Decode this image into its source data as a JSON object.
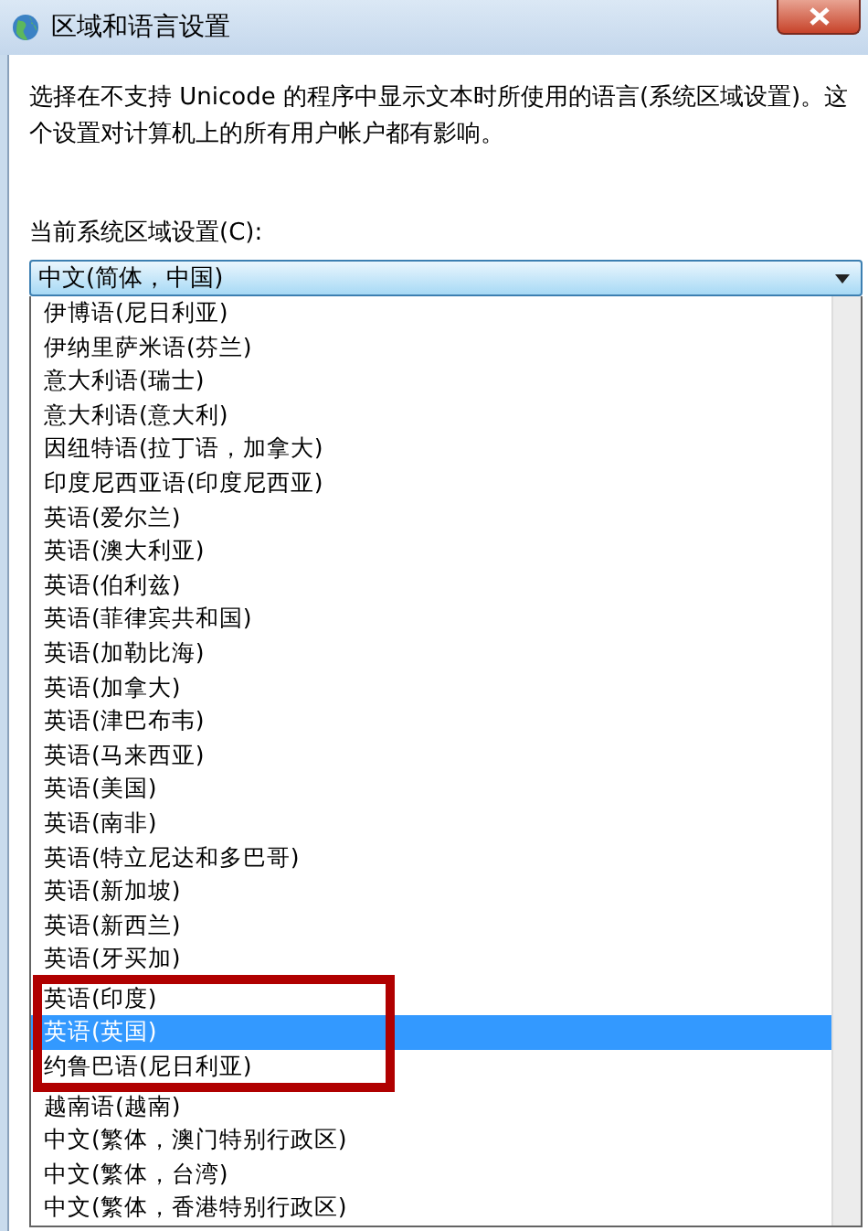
{
  "window": {
    "title": "区域和语言设置"
  },
  "description": "选择在不支持 Unicode 的程序中显示文本时所使用的语言(系统区域设置)。这个设置对计算机上的所有用户帐户都有影响。",
  "locale_label": "当前系统区域设置(C):",
  "locale_dropdown": {
    "value": "中文(简体，中国)",
    "expanded": true,
    "options": [
      {
        "label": "伊博语(尼日利亚)",
        "selected": false,
        "highlighted": false
      },
      {
        "label": "伊纳里萨米语(芬兰)",
        "selected": false,
        "highlighted": false
      },
      {
        "label": "意大利语(瑞士)",
        "selected": false,
        "highlighted": false
      },
      {
        "label": "意大利语(意大利)",
        "selected": false,
        "highlighted": false
      },
      {
        "label": "因纽特语(拉丁语，加拿大)",
        "selected": false,
        "highlighted": false
      },
      {
        "label": "印度尼西亚语(印度尼西亚)",
        "selected": false,
        "highlighted": false
      },
      {
        "label": "英语(爱尔兰)",
        "selected": false,
        "highlighted": false
      },
      {
        "label": "英语(澳大利亚)",
        "selected": false,
        "highlighted": false
      },
      {
        "label": "英语(伯利兹)",
        "selected": false,
        "highlighted": false
      },
      {
        "label": "英语(菲律宾共和国)",
        "selected": false,
        "highlighted": false
      },
      {
        "label": "英语(加勒比海)",
        "selected": false,
        "highlighted": false
      },
      {
        "label": "英语(加拿大)",
        "selected": false,
        "highlighted": false
      },
      {
        "label": "英语(津巴布韦)",
        "selected": false,
        "highlighted": false
      },
      {
        "label": "英语(马来西亚)",
        "selected": false,
        "highlighted": false
      },
      {
        "label": "英语(美国)",
        "selected": false,
        "highlighted": false
      },
      {
        "label": "英语(南非)",
        "selected": false,
        "highlighted": false
      },
      {
        "label": "英语(特立尼达和多巴哥)",
        "selected": false,
        "highlighted": false
      },
      {
        "label": "英语(新加坡)",
        "selected": false,
        "highlighted": false
      },
      {
        "label": "英语(新西兰)",
        "selected": false,
        "highlighted": false
      },
      {
        "label": "英语(牙买加)",
        "selected": false,
        "highlighted": false
      },
      {
        "label": "英语(印度)",
        "selected": false,
        "highlighted": true
      },
      {
        "label": "英语(英国)",
        "selected": true,
        "highlighted": true
      },
      {
        "label": "约鲁巴语(尼日利亚)",
        "selected": false,
        "highlighted": true
      },
      {
        "label": "越南语(越南)",
        "selected": false,
        "highlighted": false
      },
      {
        "label": "中文(繁体，澳门特别行政区)",
        "selected": false,
        "highlighted": false
      },
      {
        "label": "中文(繁体，台湾)",
        "selected": false,
        "highlighted": false
      },
      {
        "label": "中文(繁体，香港特别行政区)",
        "selected": false,
        "highlighted": false
      }
    ]
  }
}
